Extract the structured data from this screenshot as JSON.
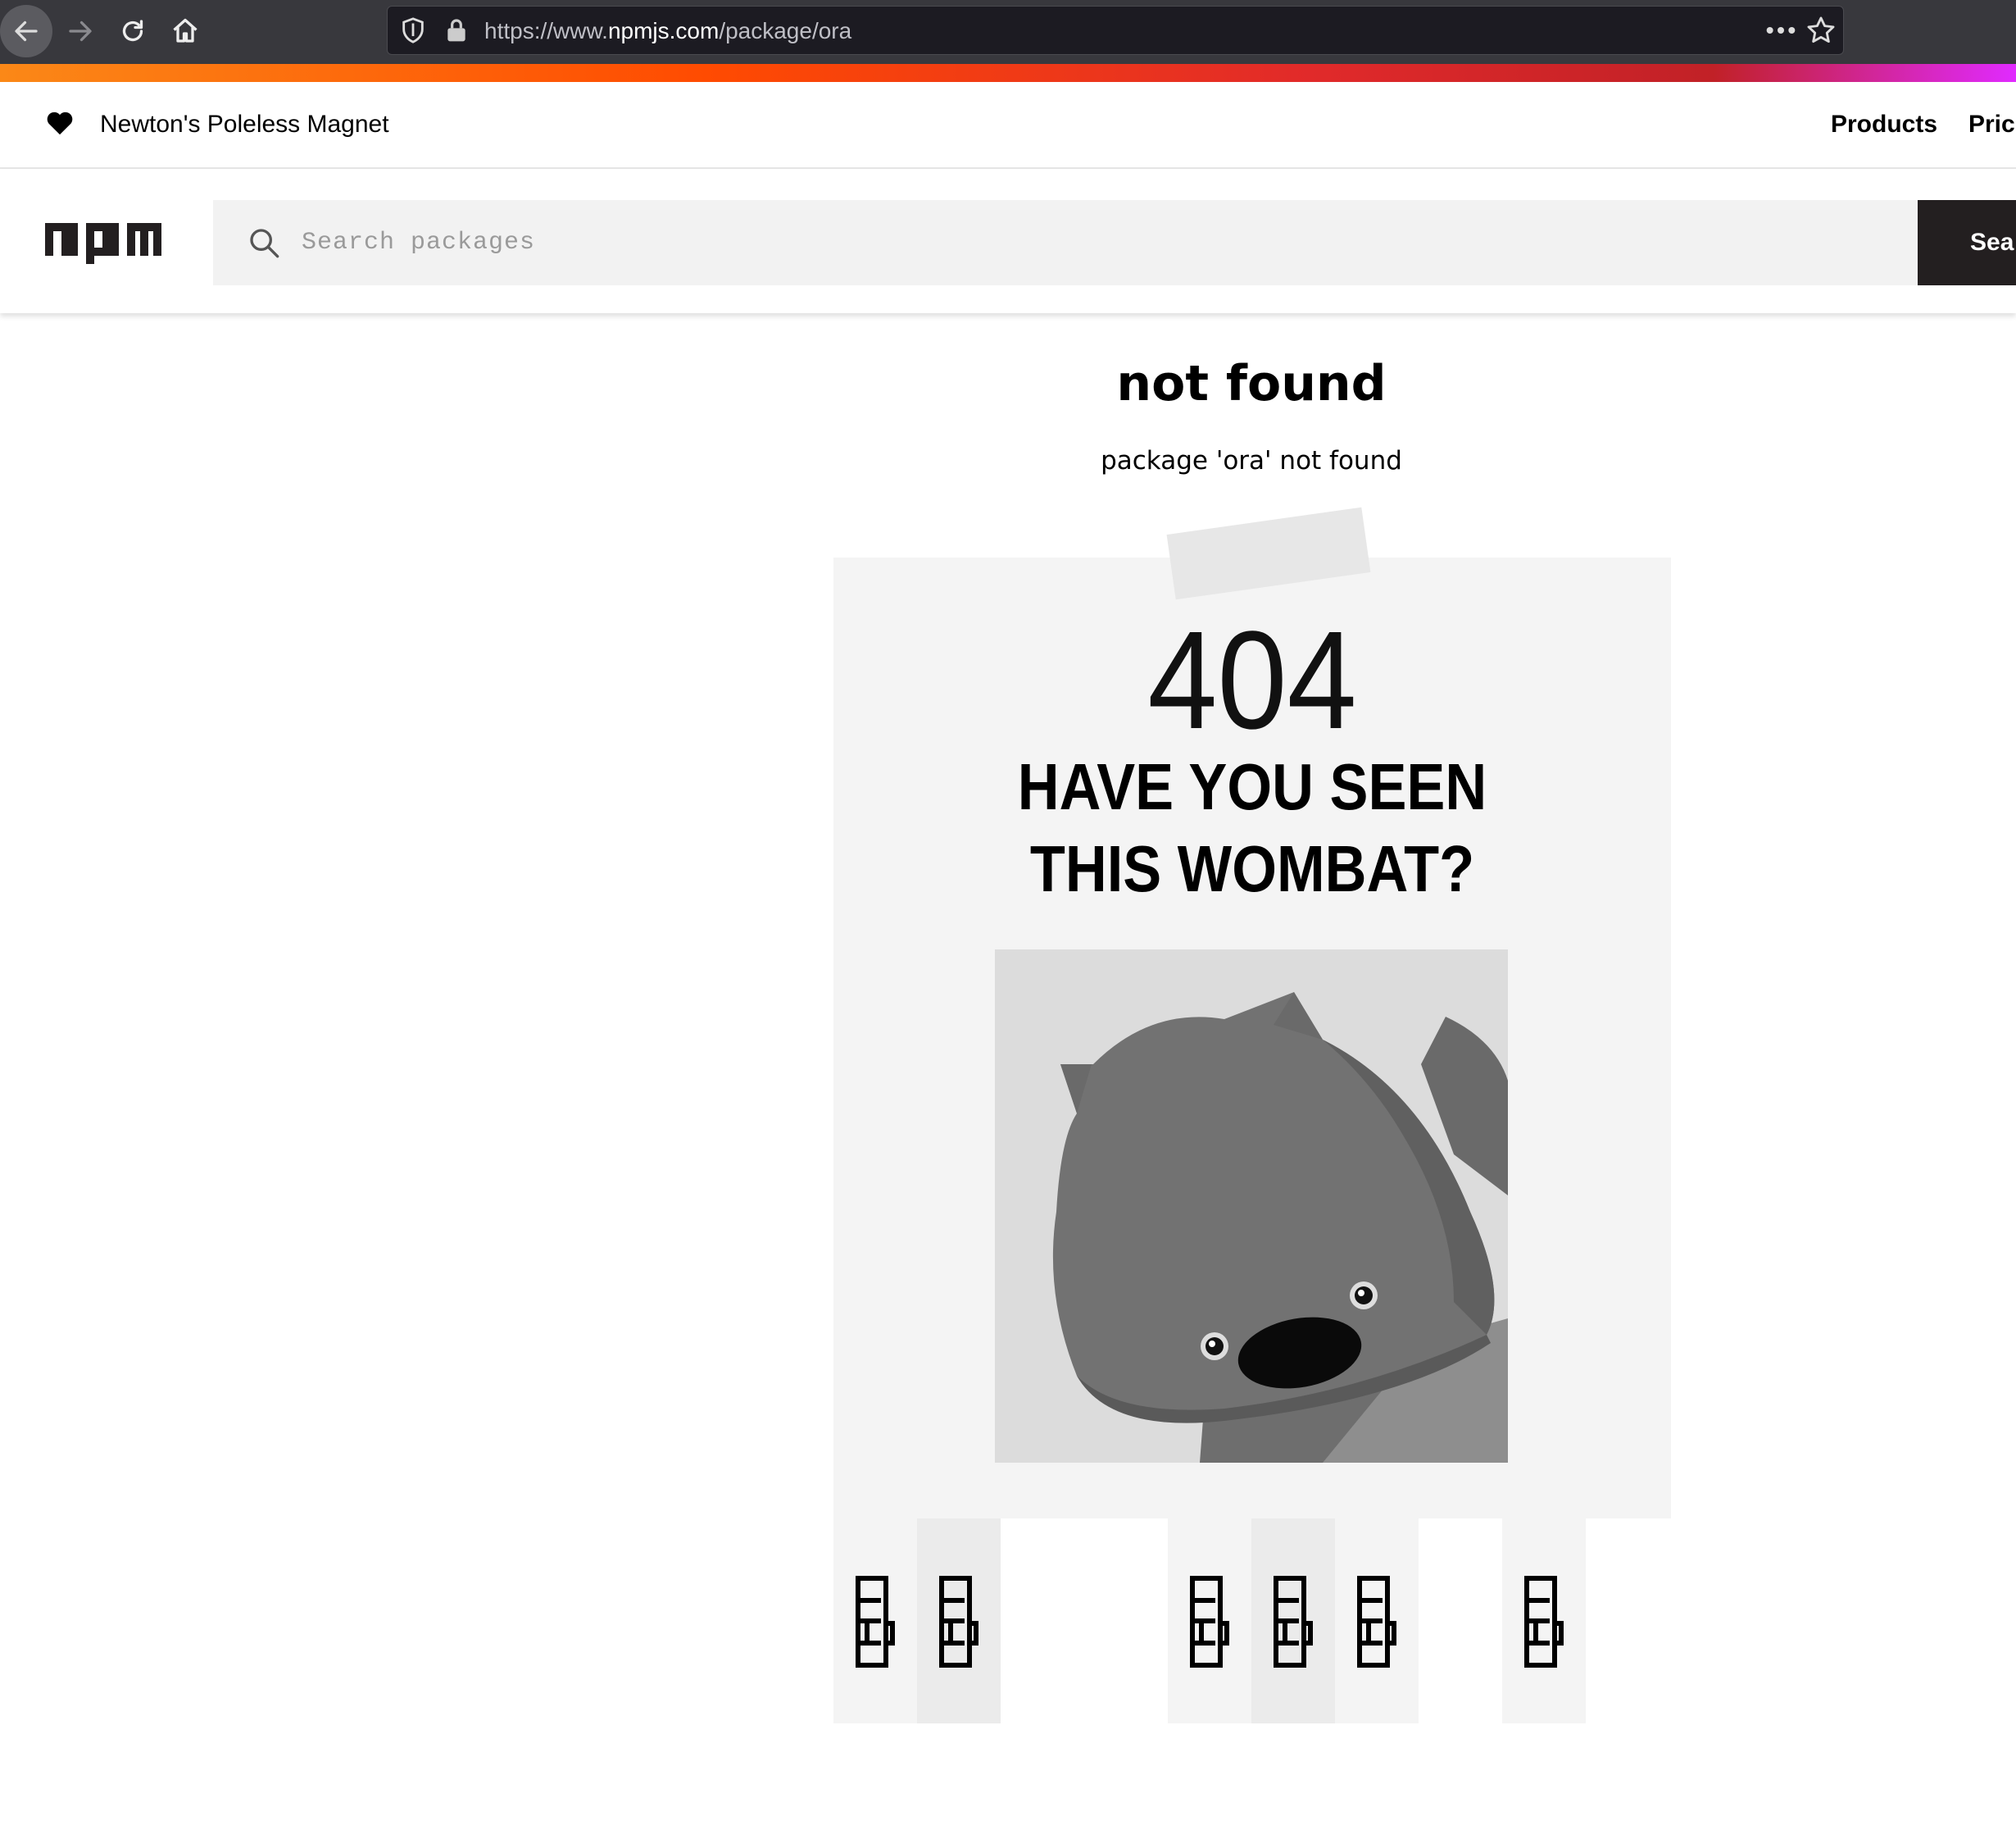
{
  "browser": {
    "url_prefix": "https://www.",
    "url_domain": "npmjs.com",
    "url_path": "/package/ora",
    "icons": [
      "back-arrow-icon",
      "forward-arrow-icon",
      "reload-icon",
      "home-icon",
      "shield-icon",
      "lock-icon",
      "more-dots-icon",
      "bookmark-star-icon"
    ]
  },
  "topbar": {
    "tagline": "Newton's Poleless Magnet",
    "products": "Products",
    "pricing": "Prici"
  },
  "search": {
    "placeholder": "Search packages",
    "button": "Sea"
  },
  "main": {
    "title": "not found",
    "subtitle": "package 'ora' not found",
    "code": "404",
    "headline_line1": "HAVE YOU SEEN",
    "headline_line2": "THIS WOMBAT?"
  },
  "poster_tabs": {
    "present": [
      true,
      true,
      false,
      false,
      true,
      true,
      true,
      false,
      true
    ]
  },
  "colors": {
    "chrome": "#38383d",
    "urlbar": "#1c1b22",
    "accent_start": "#fb8817",
    "accent_end": "#e02aff",
    "search_button": "#231f20",
    "poster": "#f4f4f4"
  }
}
